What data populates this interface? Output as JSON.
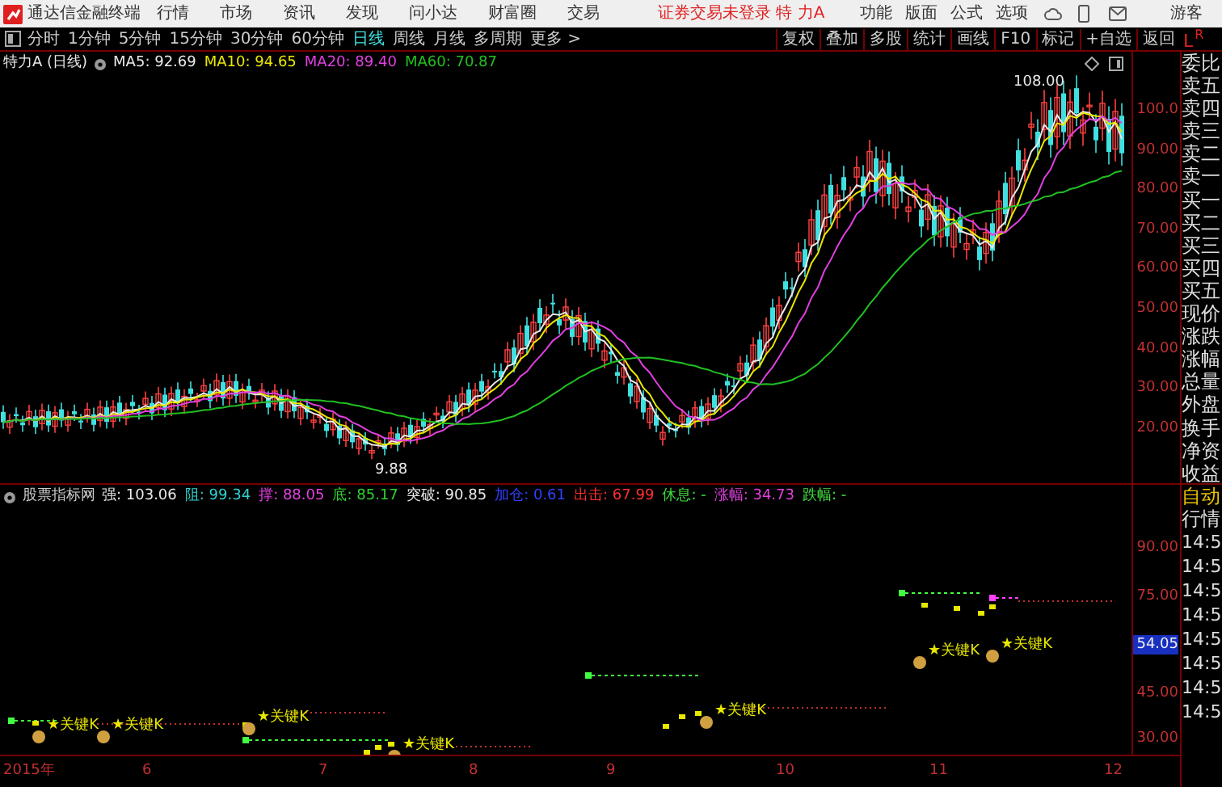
{
  "app": {
    "title": "通达信金融终端",
    "menu": [
      "行情",
      "市场",
      "资讯",
      "发现",
      "问小达",
      "财富圈",
      "交易"
    ],
    "status": "证券交易未登录  特 力A",
    "right_menu": [
      "功能",
      "版面",
      "公式",
      "选项"
    ],
    "user": "游客"
  },
  "periods": [
    {
      "label": "分时",
      "selected": false
    },
    {
      "label": "1分钟",
      "selected": false
    },
    {
      "label": "5分钟",
      "selected": false
    },
    {
      "label": "15分钟",
      "selected": false
    },
    {
      "label": "30分钟",
      "selected": false
    },
    {
      "label": "60分钟",
      "selected": false
    },
    {
      "label": "日线",
      "selected": true
    },
    {
      "label": "周线",
      "selected": false
    },
    {
      "label": "月线",
      "selected": false
    },
    {
      "label": "多周期",
      "selected": false
    },
    {
      "label": "更多 >",
      "selected": false
    }
  ],
  "level2_logo": [
    "L",
    "R"
  ],
  "tools": [
    "复权",
    "叠加",
    "多股",
    "统计",
    "画线",
    "F10",
    "标记",
    "+自选",
    "返回"
  ],
  "main_chart": {
    "title": "特力A (日线)",
    "ma": [
      {
        "label": "MA5: 92.69",
        "color": "#e8e8e8"
      },
      {
        "label": "MA10: 94.65",
        "color": "#e8e800"
      },
      {
        "label": "MA20: 89.40",
        "color": "#e040e0"
      },
      {
        "label": "MA60: 70.87",
        "color": "#20c020"
      }
    ],
    "high_label": "108.00",
    "low_label": "9.88",
    "price_ticks": [
      "100.0",
      "90.00",
      "80.00",
      "70.00",
      "60.00",
      "50.00",
      "40.00",
      "30.00",
      "20.00"
    ]
  },
  "indicator": {
    "name": "股票指标网",
    "values": [
      {
        "label": "强: 103.06",
        "color": "#e8e8e8"
      },
      {
        "label": "阻: 99.34",
        "color": "#30d0d0"
      },
      {
        "label": "撑: 88.05",
        "color": "#e040e0"
      },
      {
        "label": "底: 85.17",
        "color": "#30d030"
      },
      {
        "label": "突破: 90.85",
        "color": "#e8e8e8"
      },
      {
        "label": "加仓: 0.61",
        "color": "#3040ff"
      },
      {
        "label": "出击: 67.99",
        "color": "#ff3030"
      },
      {
        "label": "休息: -",
        "color": "#40e040"
      },
      {
        "label": "涨幅: 34.73",
        "color": "#e040e0"
      },
      {
        "label": "跌幅: -",
        "color": "#40e040"
      }
    ],
    "ticks": [
      "90.00",
      "75.00",
      "45.00",
      "30.00"
    ],
    "current": "54.05",
    "markers": [
      "★关键K",
      "★关键K",
      "★关键K",
      "★关键K",
      "★关键K",
      "★关键K",
      "★关键K"
    ]
  },
  "date_axis": [
    "2015年",
    "6",
    "7",
    "8",
    "9",
    "10",
    "11",
    "12"
  ],
  "quote_panel": [
    "委比",
    "卖五",
    "卖四",
    "卖三",
    "卖二",
    "卖一",
    "买一",
    "买二",
    "买三",
    "买四",
    "买五",
    "现价",
    "涨跌",
    "涨幅",
    "总量",
    "外盘",
    "换手",
    "净资",
    "收益"
  ],
  "ticks_panel": {
    "title": "自动",
    "subtitle": "行情",
    "times": [
      "14:5",
      "14:5",
      "14:5",
      "14:5",
      "14:5",
      "14:5",
      "14:5",
      "14:5"
    ]
  }
}
